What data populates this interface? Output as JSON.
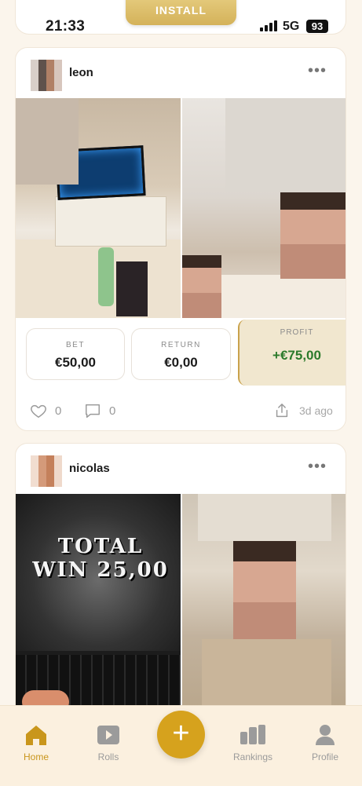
{
  "status_bar": {
    "time": "21:33",
    "network": "5G",
    "battery": "93"
  },
  "banner": {
    "install_label": "INSTALL"
  },
  "posts": [
    {
      "username": "leon",
      "more": "•••",
      "stats": {
        "bet_label": "BET",
        "bet_value": "€50,00",
        "return_label": "RETURN",
        "return_value": "€0,00",
        "profit_label": "PROFIT",
        "profit_value": "+€75,00"
      },
      "likes": "0",
      "comments": "0",
      "time_ago": "3d ago"
    },
    {
      "username": "nicolas",
      "more": "•••",
      "screen_text": "TOTAL WIN 25,00"
    }
  ],
  "nav": {
    "home": "Home",
    "rolls": "Rolls",
    "add": "+",
    "rankings": "Rankings",
    "profile": "Profile"
  },
  "colors": {
    "accent": "#d6a21d",
    "profit": "#2b7a2b",
    "background": "#fbf5ec"
  }
}
